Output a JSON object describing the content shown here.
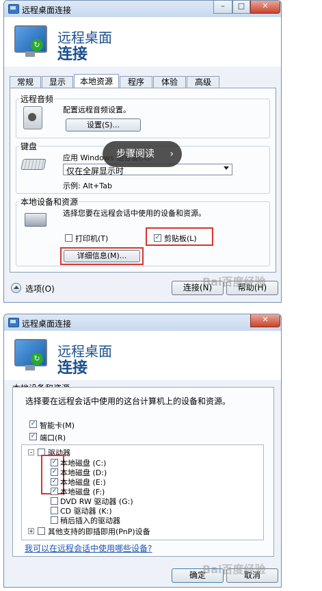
{
  "window1": {
    "title": "远程桌面连接",
    "header_line1": "远程桌面",
    "header_line2": "连接",
    "tabs": [
      {
        "label": "常规"
      },
      {
        "label": "显示"
      },
      {
        "label": "本地资源"
      },
      {
        "label": "程序"
      },
      {
        "label": "体验"
      },
      {
        "label": "高级"
      }
    ],
    "audio_group": {
      "label": "远程音频",
      "text": "配置远程音频设置。",
      "button": "设置(S)..."
    },
    "keyboard_group": {
      "label": "键盘",
      "text": "应用 Windows 组合键(K):",
      "dropdown_value": "仅在全屏显示时",
      "example": "示例: Alt+Tab"
    },
    "devices_group": {
      "label": "本地设备和资源",
      "text": "选择您要在远程会话中使用的设备和资源。",
      "printer": {
        "label": "打印机(T)",
        "checked": false
      },
      "clipboard": {
        "label": "剪贴板(L)",
        "checked": true
      },
      "details_button": "详细信息(M)..."
    },
    "options_label": "选项(O)",
    "connect_button": "连接(N)",
    "help_button": "帮助(H)",
    "overlay_text": "步骤阅读"
  },
  "window2": {
    "title": "远程桌面连接",
    "header_line1": "远程桌面",
    "header_line2": "连接",
    "section_label": "本地设备和资源",
    "section_text": "选择要在远程会话中使用的这台计算机上的设备和资源。",
    "smartcard": {
      "label": "智能卡(M)",
      "checked": true
    },
    "ports": {
      "label": "端口(R)",
      "checked": true
    },
    "drives_label": "驱动器",
    "drives": [
      {
        "label": "本地磁盘 (C:)",
        "checked": true
      },
      {
        "label": "本地磁盘 (D:)",
        "checked": true
      },
      {
        "label": "本地磁盘 (E:)",
        "checked": true
      },
      {
        "label": "本地磁盘 (F:)",
        "checked": true
      },
      {
        "label": "DVD RW 驱动器 (G:)",
        "checked": false
      },
      {
        "label": "CD 驱动器 (K:)",
        "checked": false
      },
      {
        "label": "稍后插入的驱动器",
        "checked": false
      }
    ],
    "pnp_label": "其他支持的即插即用(PnP)设备",
    "link_text": "我可以在远程会话中使用哪些设备?",
    "ok_button": "确定",
    "cancel_button": "取消"
  },
  "watermark_text": "Bai百度经验",
  "check_mark": "✓",
  "colors": {
    "highlight": "#d9322e",
    "title_blue": "#1b4f8c",
    "link": "#1d54b5"
  }
}
